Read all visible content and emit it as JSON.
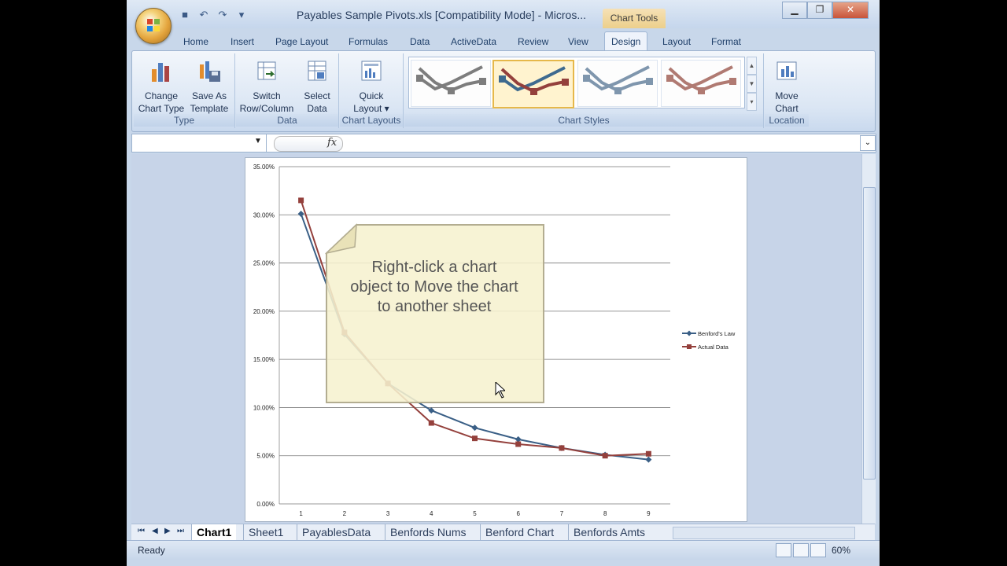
{
  "window": {
    "title": "Payables Sample Pivots.xls  [Compatibility Mode]  -  Micros...",
    "context_tab": "Chart Tools"
  },
  "ribbon_tabs": [
    "Home",
    "Insert",
    "Page Layout",
    "Formulas",
    "Data",
    "ActiveData",
    "Review",
    "View",
    "Design",
    "Layout",
    "Format"
  ],
  "active_tab": "Design",
  "ribbon": {
    "groups": {
      "type": "Type",
      "data": "Data",
      "chart_layouts": "Chart Layouts",
      "chart_styles": "Chart Styles",
      "location": "Location"
    },
    "buttons": {
      "change_chart_type": [
        "Change",
        "Chart Type"
      ],
      "save_as_template": [
        "Save As",
        "Template"
      ],
      "switch_row_column": [
        "Switch",
        "Row/Column"
      ],
      "select_data": [
        "Select",
        "Data"
      ],
      "quick_layout": [
        "Quick",
        "Layout ▾"
      ],
      "move_chart": [
        "Move",
        "Chart"
      ]
    },
    "styles": [
      {
        "color": "#7d7d7d",
        "selected": false
      },
      {
        "color": "#3e6a8f",
        "selected": true
      },
      {
        "color": "#7f96ad",
        "selected": false
      },
      {
        "color": "#b07a72",
        "selected": false
      }
    ]
  },
  "formula_bar": {
    "fx": "fx",
    "name_value": ""
  },
  "callout": {
    "lines": [
      "Right-click a chart",
      "object to Move the chart",
      "to another sheet"
    ]
  },
  "chart_data": {
    "type": "line",
    "x": [
      1,
      2,
      3,
      4,
      5,
      6,
      7,
      8,
      9
    ],
    "ylim": [
      0,
      0.35
    ],
    "ytick_labels": [
      "0.00%",
      "5.00%",
      "10.00%",
      "15.00%",
      "20.00%",
      "25.00%",
      "30.00%",
      "35.00%"
    ],
    "series": [
      {
        "name": "Benford's Law",
        "color": "#3a5f86",
        "marker": "diamond",
        "values": [
          0.301,
          0.176,
          0.125,
          0.097,
          0.079,
          0.067,
          0.058,
          0.051,
          0.046
        ]
      },
      {
        "name": "Actual Data",
        "color": "#94403c",
        "marker": "square",
        "values": [
          0.315,
          0.178,
          0.125,
          0.084,
          0.068,
          0.062,
          0.058,
          0.05,
          0.052
        ]
      }
    ],
    "grid": true,
    "legend": "right"
  },
  "sheet_tabs": [
    "Chart1",
    "Sheet1",
    "PayablesData",
    "Benfords Nums",
    "Benford Chart",
    "Benfords Amts"
  ],
  "active_sheet": "Chart1",
  "status": {
    "ready": "Ready",
    "zoom": "60%"
  },
  "icons": {
    "nav_first": "first-sheet-icon",
    "nav_prev": "prev-sheet-icon",
    "nav_next": "next-sheet-icon",
    "nav_last": "last-sheet-icon"
  }
}
